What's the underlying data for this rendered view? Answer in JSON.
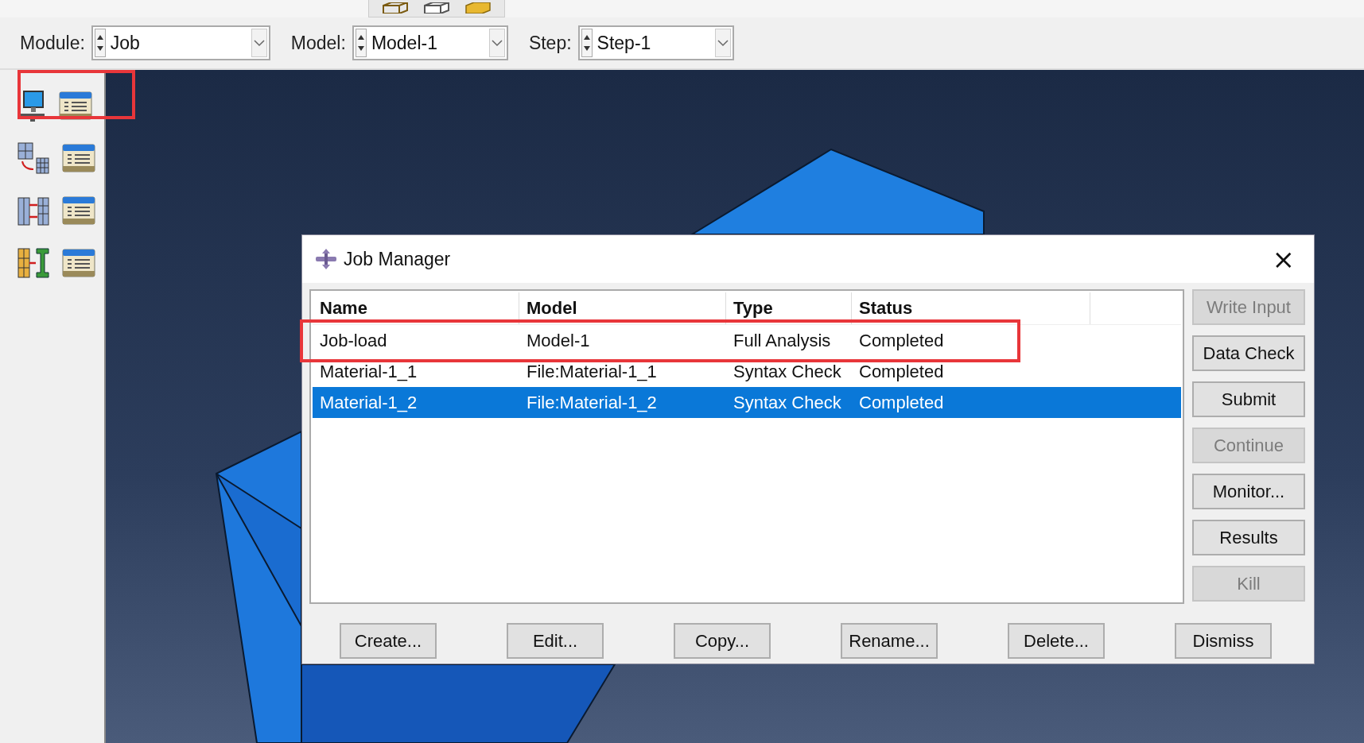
{
  "toolbar": {
    "selectors": [
      {
        "label": "Module:",
        "value": "Job"
      },
      {
        "label": "Model:",
        "value": "Model-1"
      },
      {
        "label": "Step:",
        "value": "Step-1"
      }
    ]
  },
  "dialog": {
    "title": "Job Manager",
    "close": "×",
    "columns": [
      "Name",
      "Model",
      "Type",
      "Status"
    ],
    "rows": [
      {
        "cells": [
          "Job-load",
          "Model-1",
          "Full Analysis",
          "Completed"
        ],
        "selected": false
      },
      {
        "cells": [
          "Material-1_1",
          "File:Material-1_1",
          "Syntax Check",
          "Completed"
        ],
        "selected": false
      },
      {
        "cells": [
          "Material-1_2",
          "File:Material-1_2",
          "Syntax Check",
          "Completed"
        ],
        "selected": true
      }
    ],
    "side_buttons": [
      {
        "label": "Write Input",
        "disabled": true
      },
      {
        "label": "Data Check",
        "disabled": false
      },
      {
        "label": "Submit",
        "disabled": false
      },
      {
        "label": "Continue",
        "disabled": true
      },
      {
        "label": "Monitor...",
        "disabled": false
      },
      {
        "label": "Results",
        "disabled": false
      },
      {
        "label": "Kill",
        "disabled": true
      }
    ],
    "bottom_buttons": [
      "Create...",
      "Edit...",
      "Copy...",
      "Rename...",
      "Delete...",
      "Dismiss"
    ]
  }
}
